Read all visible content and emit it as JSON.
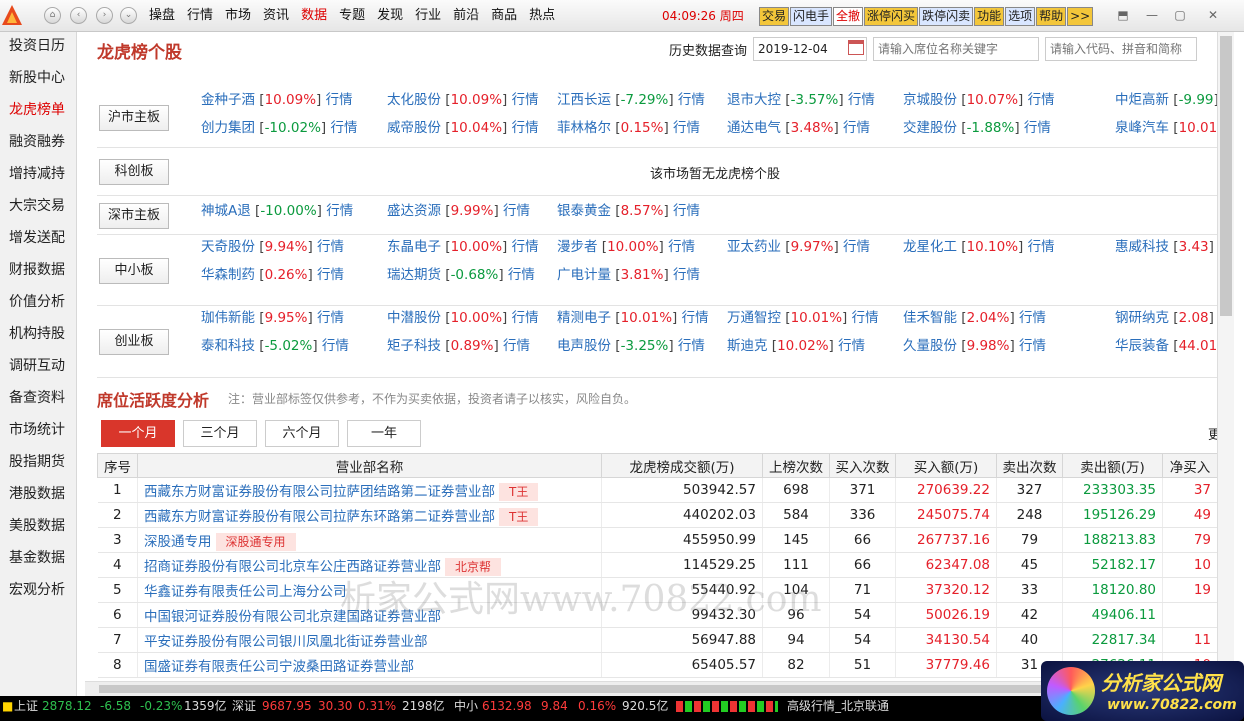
{
  "menu": [
    "操盘",
    "行情",
    "市场",
    "资讯",
    "数据",
    "专题",
    "发现",
    "行业",
    "前沿",
    "商品",
    "热点"
  ],
  "menu_active": "数据",
  "clock": "04:09:26",
  "weekday": "周四",
  "toolbar": [
    {
      "label": "交易",
      "bg": "#f3c63a"
    },
    {
      "label": "闪电手",
      "bg": "#d9e6ff"
    },
    {
      "label": "全撤",
      "bg": "#ffffff",
      "color": "#d00"
    },
    {
      "label": "涨停闪买",
      "bg": "#f3c63a"
    },
    {
      "label": "跌停闪卖",
      "bg": "#d9e6ff"
    },
    {
      "label": "功能",
      "bg": "#f3c63a"
    },
    {
      "label": "选项",
      "bg": "#d9e6ff"
    },
    {
      "label": "帮助",
      "bg": "#f3c63a"
    },
    {
      "label": ">>",
      "bg": "#f3c63a"
    }
  ],
  "sidebar": [
    "投资日历",
    "新股中心",
    "龙虎榜单",
    "融资融券",
    "增持减持",
    "大宗交易",
    "增发送配",
    "财报数据",
    "价值分析",
    "机构持股",
    "调研互动",
    "备查资料",
    "市场统计",
    "股指期货",
    "港股数据",
    "美股数据",
    "基金数据",
    "宏观分析"
  ],
  "sidebar_active": "龙虎榜单",
  "page_title": "龙虎榜个股",
  "history": {
    "label": "历史数据查询",
    "date": "2019-12-04",
    "seat_placeholder": "请输入席位名称关键字",
    "code_placeholder": "请输入代码、拼音和简称"
  },
  "quote_link": "行情",
  "markets": [
    {
      "name": "沪市主板",
      "rows": [
        [
          {
            "n": "金种子酒",
            "p": "10.09%"
          },
          {
            "n": "太化股份",
            "p": "10.09%"
          },
          {
            "n": "江西长运",
            "p": "-7.29%"
          },
          {
            "n": "退市大控",
            "p": "-3.57%"
          },
          {
            "n": "京城股份",
            "p": "10.07%"
          },
          {
            "n": "中炬高新",
            "p": "-9.99"
          }
        ],
        [
          {
            "n": "创力集团",
            "p": "-10.02%"
          },
          {
            "n": "威帝股份",
            "p": "10.04%"
          },
          {
            "n": "菲林格尔",
            "p": "0.15%"
          },
          {
            "n": "通达电气",
            "p": "3.48%"
          },
          {
            "n": "交建股份",
            "p": "-1.88%"
          },
          {
            "n": "泉峰汽车",
            "p": "10.01"
          }
        ]
      ]
    },
    {
      "name": "科创板",
      "rows": [],
      "empty": "该市场暂无龙虎榜个股"
    },
    {
      "name": "深市主板",
      "rows": [
        [
          {
            "n": "神城A退",
            "p": "-10.00%"
          },
          {
            "n": "盛达资源",
            "p": "9.99%"
          },
          {
            "n": "银泰黄金",
            "p": "8.57%"
          }
        ]
      ]
    },
    {
      "name": "中小板",
      "rows": [
        [
          {
            "n": "天奇股份",
            "p": "9.94%"
          },
          {
            "n": "东晶电子",
            "p": "10.00%"
          },
          {
            "n": "漫步者",
            "p": "10.00%"
          },
          {
            "n": "亚太药业",
            "p": "9.97%"
          },
          {
            "n": "龙星化工",
            "p": "10.10%"
          },
          {
            "n": "惠威科技",
            "p": "3.43"
          }
        ],
        [
          {
            "n": "华森制药",
            "p": "0.26%"
          },
          {
            "n": "瑞达期货",
            "p": "-0.68%"
          },
          {
            "n": "广电计量",
            "p": "3.81%"
          }
        ]
      ]
    },
    {
      "name": "创业板",
      "rows": [
        [
          {
            "n": "珈伟新能",
            "p": "9.95%"
          },
          {
            "n": "中潜股份",
            "p": "10.00%"
          },
          {
            "n": "精测电子",
            "p": "10.01%"
          },
          {
            "n": "万通智控",
            "p": "10.01%"
          },
          {
            "n": "佳禾智能",
            "p": "2.04%"
          },
          {
            "n": "钢研纳克",
            "p": "2.08"
          }
        ],
        [
          {
            "n": "泰和科技",
            "p": "-5.02%"
          },
          {
            "n": "矩子科技",
            "p": "0.89%"
          },
          {
            "n": "电声股份",
            "p": "-3.25%"
          },
          {
            "n": "斯迪克",
            "p": "10.02%"
          },
          {
            "n": "久量股份",
            "p": "9.98%"
          },
          {
            "n": "华辰装备",
            "p": "44.01"
          }
        ]
      ]
    }
  ],
  "analysis": {
    "title": "席位活跃度分析",
    "note": "注：营业部标签仅供参考，不作为买卖依据，投资者请子以核实，风险自负。",
    "tabs": [
      "一个月",
      "三个月",
      "六个月",
      "一年"
    ],
    "active_tab": "一个月",
    "more": "更",
    "columns": [
      "序号",
      "营业部名称",
      "龙虎榜成交额(万)",
      "上榜次数",
      "买入次数",
      "买入额(万)",
      "卖出次数",
      "卖出额(万)",
      "净买入"
    ],
    "rows": [
      {
        "i": "1",
        "name": "西藏东方财富证券股份有限公司拉萨团结路第二证券营业部",
        "tag": "T王",
        "amt": "503942.57",
        "times": "698",
        "bt": "371",
        "buy": "270639.22",
        "st": "327",
        "sell": "233303.35",
        "net": "37"
      },
      {
        "i": "2",
        "name": "西藏东方财富证券股份有限公司拉萨东环路第二证券营业部",
        "tag": "T王",
        "amt": "440202.03",
        "times": "584",
        "bt": "336",
        "buy": "245075.74",
        "st": "248",
        "sell": "195126.29",
        "net": "49"
      },
      {
        "i": "3",
        "name": "深股通专用",
        "tag": "深股通专用",
        "amt": "455950.99",
        "times": "145",
        "bt": "66",
        "buy": "267737.16",
        "st": "79",
        "sell": "188213.83",
        "net": "79"
      },
      {
        "i": "4",
        "name": "招商证券股份有限公司北京车公庄西路证券营业部",
        "tag": "北京帮",
        "amt": "114529.25",
        "times": "111",
        "bt": "66",
        "buy": "62347.08",
        "st": "45",
        "sell": "52182.17",
        "net": "10"
      },
      {
        "i": "5",
        "name": "华鑫证券有限责任公司上海分公司",
        "tag": "",
        "amt": "55440.92",
        "times": "104",
        "bt": "71",
        "buy": "37320.12",
        "st": "33",
        "sell": "18120.80",
        "net": "19"
      },
      {
        "i": "6",
        "name": "中国银河证券股份有限公司北京建国路证券营业部",
        "tag": "",
        "amt": "99432.30",
        "times": "96",
        "bt": "54",
        "buy": "50026.19",
        "st": "42",
        "sell": "49406.11",
        "net": ""
      },
      {
        "i": "7",
        "name": "平安证券股份有限公司银川凤凰北街证券营业部",
        "tag": "",
        "amt": "56947.88",
        "times": "94",
        "bt": "54",
        "buy": "34130.54",
        "st": "40",
        "sell": "22817.34",
        "net": "11"
      },
      {
        "i": "8",
        "name": "国盛证券有限责任公司宁波桑田路证券营业部",
        "tag": "",
        "amt": "65405.57",
        "times": "82",
        "bt": "51",
        "buy": "37779.46",
        "st": "31",
        "sell": "27626.11",
        "net": "10"
      }
    ]
  },
  "watermark": "析家公式网www.70822.com",
  "status": {
    "sh": {
      "name": "上证",
      "val": "2878.12",
      "chg": "-6.58",
      "pct": "-0.23%",
      "vol": "1359亿"
    },
    "sz": {
      "name": "深证",
      "val": "9687.95",
      "chg": "30.30",
      "pct": "0.31%",
      "vol": "2198亿"
    },
    "zx": {
      "name": "中小",
      "val": "6132.98",
      "chg": "9.84",
      "pct": "0.16%",
      "vol": "920.5亿"
    },
    "feed": "高级行情_北京联通"
  },
  "brand": {
    "t1": "分析家公式网",
    "t2": "www.70822.com"
  },
  "colors": {
    "accent": "#c0392b",
    "up": "#e5202a",
    "down": "#0b9a3e",
    "link": "#2a6ebb"
  }
}
